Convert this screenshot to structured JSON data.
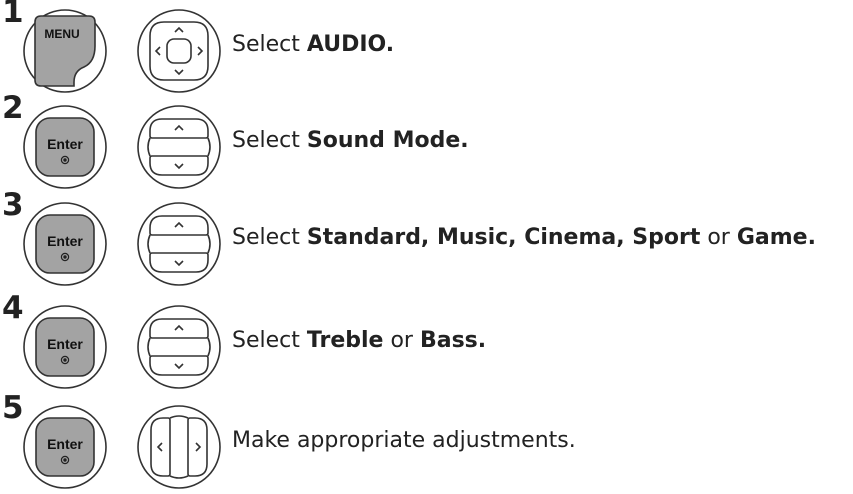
{
  "steps": [
    {
      "number": "1",
      "left_button": "MENU",
      "nav_icon": "dpad-all-directions-icon",
      "parts": [
        {
          "t": "Select ",
          "b": false
        },
        {
          "t": "AUDIO.",
          "b": true
        }
      ]
    },
    {
      "number": "2",
      "left_button": "Enter",
      "nav_icon": "dpad-up-down-icon",
      "parts": [
        {
          "t": "Select ",
          "b": false
        },
        {
          "t": "Sound Mode.",
          "b": true
        }
      ]
    },
    {
      "number": "3",
      "left_button": "Enter",
      "nav_icon": "dpad-up-down-icon",
      "parts": [
        {
          "t": "Select ",
          "b": false
        },
        {
          "t": "Standard, Music, Cinema, Sport",
          "b": true
        },
        {
          "t": " or ",
          "b": false
        },
        {
          "t": "Game.",
          "b": true
        }
      ]
    },
    {
      "number": "4",
      "left_button": "Enter",
      "nav_icon": "dpad-up-down-icon",
      "parts": [
        {
          "t": "Select ",
          "b": false
        },
        {
          "t": "Treble",
          "b": true
        },
        {
          "t": " or ",
          "b": false
        },
        {
          "t": "Bass.",
          "b": true
        }
      ]
    },
    {
      "number": "5",
      "left_button": "Enter",
      "nav_icon": "dpad-left-right-icon",
      "parts": [
        {
          "t": "Make appropriate adjustments.",
          "b": false
        }
      ]
    }
  ],
  "colors": {
    "button_fill": "#a3a3a3",
    "outline": "#333333",
    "background": "#ffffff"
  }
}
